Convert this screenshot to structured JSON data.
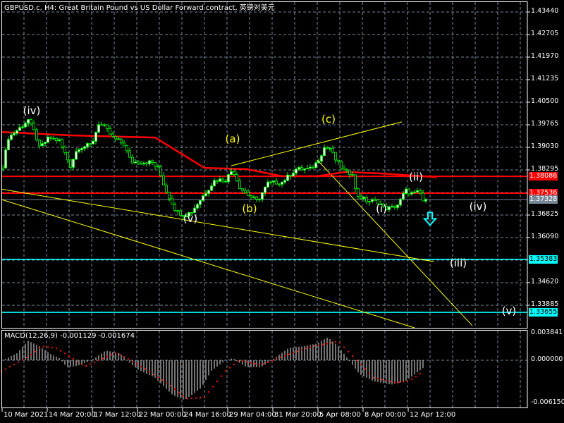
{
  "header": {
    "title": "GBPUSD.c, H4:  Great Britain Pound vs US Dollar Forward contract, 英镑对美元",
    "macd_title": "MACD(12,26,9) -0.001129 -0.001674"
  },
  "colors": {
    "background": "#000000",
    "candle": "#00ff00",
    "ma": "#ff0000",
    "trendline": "#ffff00",
    "support": "#00ffff",
    "grid": "#778899",
    "hist": "#c0c0c0",
    "signal": "#ff0000"
  },
  "chart_data": {
    "type": "candlestick",
    "symbol": "GBPUSD.c",
    "timeframe": "H4",
    "price_axis": {
      "ticks": [
        "1.43440",
        "1.42705",
        "1.41970",
        "1.41235",
        "1.40500",
        "1.39765",
        "1.39030",
        "1.38295",
        "1.36825",
        "1.36090",
        "1.34620",
        "1.33885"
      ],
      "range": [
        1.3312,
        1.4375
      ]
    },
    "time_axis": {
      "labels": [
        {
          "bar": 0,
          "text": "10 Mar 2021"
        },
        {
          "bar": 16,
          "text": "14 Mar 20:00"
        },
        {
          "bar": 32,
          "text": "17 Mar 12:00"
        },
        {
          "bar": 48,
          "text": "22 Mar 00:00"
        },
        {
          "bar": 64,
          "text": "24 Mar 16:00"
        },
        {
          "bar": 80,
          "text": "29 Mar 04:00"
        },
        {
          "bar": 96,
          "text": "31 Mar 20:00"
        },
        {
          "bar": 112,
          "text": "5 Apr 08:00"
        },
        {
          "bar": 128,
          "text": "8 Apr 00:00"
        },
        {
          "bar": 144,
          "text": "12 Apr 12:00"
        }
      ]
    },
    "price_path": [
      [
        0,
        1.3843
      ],
      [
        2,
        1.3935
      ],
      [
        6.5,
        1.397
      ],
      [
        9,
        1.3993
      ],
      [
        11.5,
        1.3947
      ],
      [
        13,
        1.3901
      ],
      [
        16.5,
        1.3935
      ],
      [
        20,
        1.3924
      ],
      [
        24,
        1.3843
      ],
      [
        26.5,
        1.3901
      ],
      [
        31.5,
        1.3912
      ],
      [
        34,
        1.3981
      ],
      [
        36,
        1.397
      ],
      [
        39,
        1.3935
      ],
      [
        43,
        1.3912
      ],
      [
        45.5,
        1.3855
      ],
      [
        49,
        1.3855
      ],
      [
        52.75,
        1.3855
      ],
      [
        55.25,
        1.3832
      ],
      [
        57.75,
        1.3763
      ],
      [
        61.5,
        1.3694
      ],
      [
        64.5,
        1.3682
      ],
      [
        67,
        1.3694
      ],
      [
        71.5,
        1.3751
      ],
      [
        75.25,
        1.3797
      ],
      [
        79,
        1.3797
      ],
      [
        81.5,
        1.3832
      ],
      [
        84,
        1.3774
      ],
      [
        86.5,
        1.3751
      ],
      [
        90.25,
        1.3728
      ],
      [
        94,
        1.3786
      ],
      [
        99,
        1.379
      ],
      [
        104,
        1.3832
      ],
      [
        109,
        1.3832
      ],
      [
        111.5,
        1.3855
      ],
      [
        114,
        1.3901
      ],
      [
        116,
        1.3901
      ],
      [
        117.75,
        1.3866
      ],
      [
        121.5,
        1.382
      ],
      [
        124,
        1.382
      ],
      [
        125.25,
        1.3751
      ],
      [
        129,
        1.3728
      ],
      [
        132.75,
        1.3728
      ],
      [
        135.25,
        1.3705
      ],
      [
        137.75,
        1.3705
      ],
      [
        140.25,
        1.3717
      ],
      [
        142.75,
        1.3763
      ],
      [
        145.25,
        1.3751
      ],
      [
        147.75,
        1.3758
      ],
      [
        150,
        1.3705
      ]
    ],
    "moving_average": [
      [
        -0.5,
        1.3953
      ],
      [
        24,
        1.3942
      ],
      [
        54,
        1.3935
      ],
      [
        71.5,
        1.3836
      ],
      [
        86.5,
        1.3832
      ],
      [
        99,
        1.3809
      ],
      [
        111.5,
        1.3809
      ],
      [
        121.5,
        1.3823
      ],
      [
        134,
        1.3818
      ],
      [
        154,
        1.3806
      ]
    ],
    "levels": [
      {
        "price": 1.38086,
        "label": "1.38086",
        "color": "#ff0000",
        "type": "red-line"
      },
      {
        "price": 1.37536,
        "label": "1.37536",
        "color": "#ff0000",
        "type": "red-line"
      },
      {
        "price": 1.37328,
        "label": "1.37328",
        "color": "#778899",
        "type": "bid-line"
      },
      {
        "price": 1.35383,
        "label": "1.35383",
        "color": "#00ffff",
        "type": "support"
      },
      {
        "price": 1.33655,
        "label": "1.33655",
        "color": "#00ffff",
        "type": "support"
      }
    ],
    "trendlines": [
      [
        [
          -0.5,
          1.3767
        ],
        [
          152.75,
          1.3531
        ]
      ],
      [
        [
          -0.5,
          1.3733
        ],
        [
          146,
          1.3315
        ]
      ],
      [
        [
          81,
          1.3843
        ],
        [
          141.5,
          1.3986
        ]
      ],
      [
        [
          111.5,
          1.3862
        ],
        [
          166.5,
          1.3322
        ]
      ]
    ],
    "wave_labels": [
      {
        "text": "(iv)",
        "bar": 10.25,
        "price": 1.4023,
        "color": "#ffffff"
      },
      {
        "text": "(a)",
        "bar": 81.5,
        "price": 1.393,
        "color": "#ffff00"
      },
      {
        "text": "(v)",
        "bar": 66.5,
        "price": 1.3672,
        "color": "#ffffff"
      },
      {
        "text": "(b)",
        "bar": 87.5,
        "price": 1.3704,
        "color": "#ffff00"
      },
      {
        "text": "(c)",
        "bar": 115.5,
        "price": 1.3994,
        "color": "#ffff00"
      },
      {
        "text": "(ii)",
        "bar": 146.5,
        "price": 1.3807,
        "color": "#ffffff"
      },
      {
        "text": "(i)",
        "bar": 134.25,
        "price": 1.3704,
        "color": "#ffffff"
      },
      {
        "text": "(iv)",
        "bar": 168.5,
        "price": 1.3709,
        "color": "#ffffff"
      },
      {
        "text": "(iii)",
        "bar": 161.5,
        "price": 1.3527,
        "color": "#ffffff"
      },
      {
        "text": "(v)",
        "bar": 179.5,
        "price": 1.337,
        "color": "#ffffff"
      }
    ],
    "arrow": {
      "type": "down-arrow",
      "bar": 151.5,
      "price": 1.3668,
      "color": "#00ffff"
    },
    "macd": {
      "params": "12,26,9",
      "value": -0.001129,
      "signal_value": -0.001674,
      "axis_ticks": [
        "0.003841",
        "0.000000",
        "-0.006150"
      ],
      "range": [
        -0.00615,
        0.003841
      ],
      "histogram_path": [
        [
          0,
          0
        ],
        [
          5,
          1.0
        ],
        [
          9,
          2.8
        ],
        [
          13,
          2.0
        ],
        [
          16.5,
          1.0
        ],
        [
          20,
          0.3
        ],
        [
          22.75,
          -1.0
        ],
        [
          26.5,
          -0.8
        ],
        [
          31.5,
          0
        ],
        [
          36.5,
          1.4
        ],
        [
          41.5,
          1.0
        ],
        [
          44,
          0
        ],
        [
          47.75,
          -1.3
        ],
        [
          54,
          -2.5
        ],
        [
          60.25,
          -5.0
        ],
        [
          64.5,
          -5.7
        ],
        [
          70.25,
          -4.0
        ],
        [
          74,
          -1.5
        ],
        [
          79,
          0
        ],
        [
          81.5,
          0.3
        ],
        [
          86.5,
          -1.0
        ],
        [
          91.5,
          -1.0
        ],
        [
          95.25,
          0
        ],
        [
          101.5,
          1.8
        ],
        [
          106.5,
          2.0
        ],
        [
          111.5,
          2.4
        ],
        [
          115.25,
          3.3
        ],
        [
          119,
          2.0
        ],
        [
          122.75,
          0
        ],
        [
          126.5,
          -2.0
        ],
        [
          131.5,
          -3.0
        ],
        [
          137.75,
          -3.5
        ],
        [
          142.75,
          -3.0
        ],
        [
          149,
          -1.13
        ]
      ],
      "signal_path": [
        [
          -0.5,
          -1.6
        ],
        [
          9,
          0.5
        ],
        [
          14,
          2.0
        ],
        [
          19,
          1.7
        ],
        [
          24,
          0.5
        ],
        [
          29,
          -0.9
        ],
        [
          34,
          0
        ],
        [
          40.25,
          1.1
        ],
        [
          45.25,
          0
        ],
        [
          51.5,
          -1.5
        ],
        [
          59,
          -3.5
        ],
        [
          65.25,
          -5.5
        ],
        [
          71.5,
          -5.3
        ],
        [
          79,
          -1.5
        ],
        [
          84,
          0
        ],
        [
          91.5,
          -0.7
        ],
        [
          99,
          0.5
        ],
        [
          109,
          1.9
        ],
        [
          119,
          2.7
        ],
        [
          124,
          0.6
        ],
        [
          131.5,
          -2.5
        ],
        [
          139,
          -3.2
        ],
        [
          144,
          -3.0
        ],
        [
          149,
          -1.67
        ]
      ]
    }
  }
}
